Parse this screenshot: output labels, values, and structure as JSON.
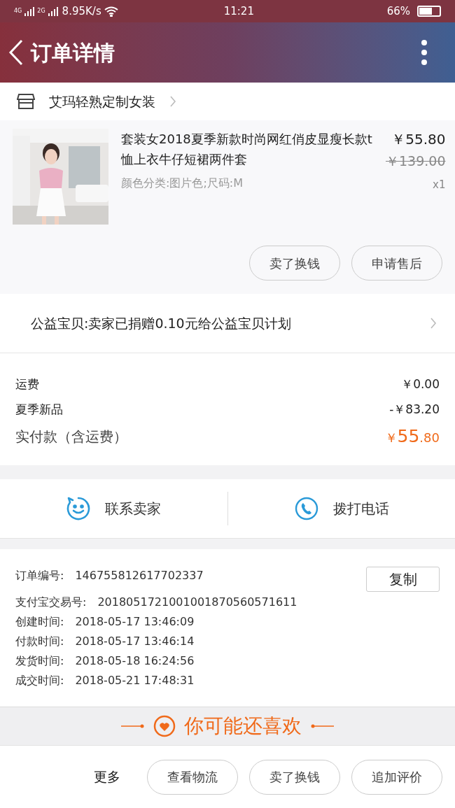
{
  "status_bar": {
    "network_1": "4G",
    "network_2": "2G",
    "speed": "8.95K/s",
    "time": "11:21",
    "battery": "66%"
  },
  "header": {
    "title": "订单详情"
  },
  "shop": {
    "name": "艾玛轻熟定制女装"
  },
  "product": {
    "title": "套装女2018夏季新款时尚网红俏皮显瘦长款t恤上衣牛仔短裙两件套",
    "variant": "颜色分类:图片色;尺码:M",
    "price": "￥55.80",
    "original_price": "￥139.00",
    "quantity": "x1",
    "actions": [
      "卖了换钱",
      "申请售后"
    ]
  },
  "charity": {
    "text": "公益宝贝:卖家已捐赠0.10元给公益宝贝计划"
  },
  "costs": [
    {
      "label": "运费",
      "value": "￥0.00"
    },
    {
      "label": "夏季新品",
      "value": "-￥83.20"
    }
  ],
  "total": {
    "label": "实付款（含运费）",
    "currency": "￥",
    "integer": "55",
    "decimal": ".80"
  },
  "contact": [
    {
      "kind": "chat",
      "label": "联系卖家"
    },
    {
      "kind": "phone",
      "label": "拨打电话"
    }
  ],
  "order_info": {
    "copy_button": "复制",
    "rows": [
      {
        "label": "订单编号:",
        "value": "146755812617702337"
      },
      {
        "label": "支付宝交易号:",
        "value": "2018051721001001870560571611"
      },
      {
        "label": "创建时间:",
        "value": "2018-05-17 13:46:09"
      },
      {
        "label": "付款时间:",
        "value": "2018-05-17 13:46:14"
      },
      {
        "label": "发货时间:",
        "value": "2018-05-18 16:24:56"
      },
      {
        "label": "成交时间:",
        "value": "2018-05-21 17:48:31"
      }
    ]
  },
  "recommend": {
    "title": "你可能还喜欢"
  },
  "bottom_bar": {
    "more": "更多",
    "buttons": [
      "查看物流",
      "卖了换钱",
      "追加评价"
    ]
  }
}
